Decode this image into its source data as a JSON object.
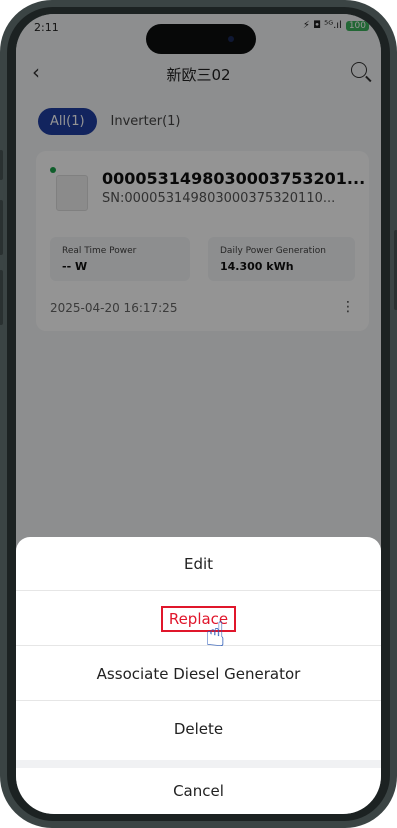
{
  "status_bar": {
    "time": "2:11",
    "icons": "⚡ ◘ ⁵ᴳ.ıl",
    "battery": "100"
  },
  "nav": {
    "title": "新欧三02",
    "back_icon": "chevron-left-icon",
    "search_icon": "search-icon"
  },
  "tabs": [
    {
      "label": "All(1)"
    },
    {
      "label": "Inverter(1)"
    }
  ],
  "device": {
    "name": "000053149803000375320​1...",
    "sn": "SN:000053149803000375320110...",
    "metrics": [
      {
        "label": "Real Time Power",
        "value": "-- W"
      },
      {
        "label": "Daily Power Generation",
        "value": "14.300 kWh"
      }
    ],
    "date": "2025-04-20 16:17:25"
  },
  "sheet": {
    "edit": "Edit",
    "replace": "Replace",
    "associate": "Associate Diesel Generator",
    "delete": "Delete",
    "cancel": "Cancel"
  },
  "cursor_icon": "hand-pointer-icon"
}
